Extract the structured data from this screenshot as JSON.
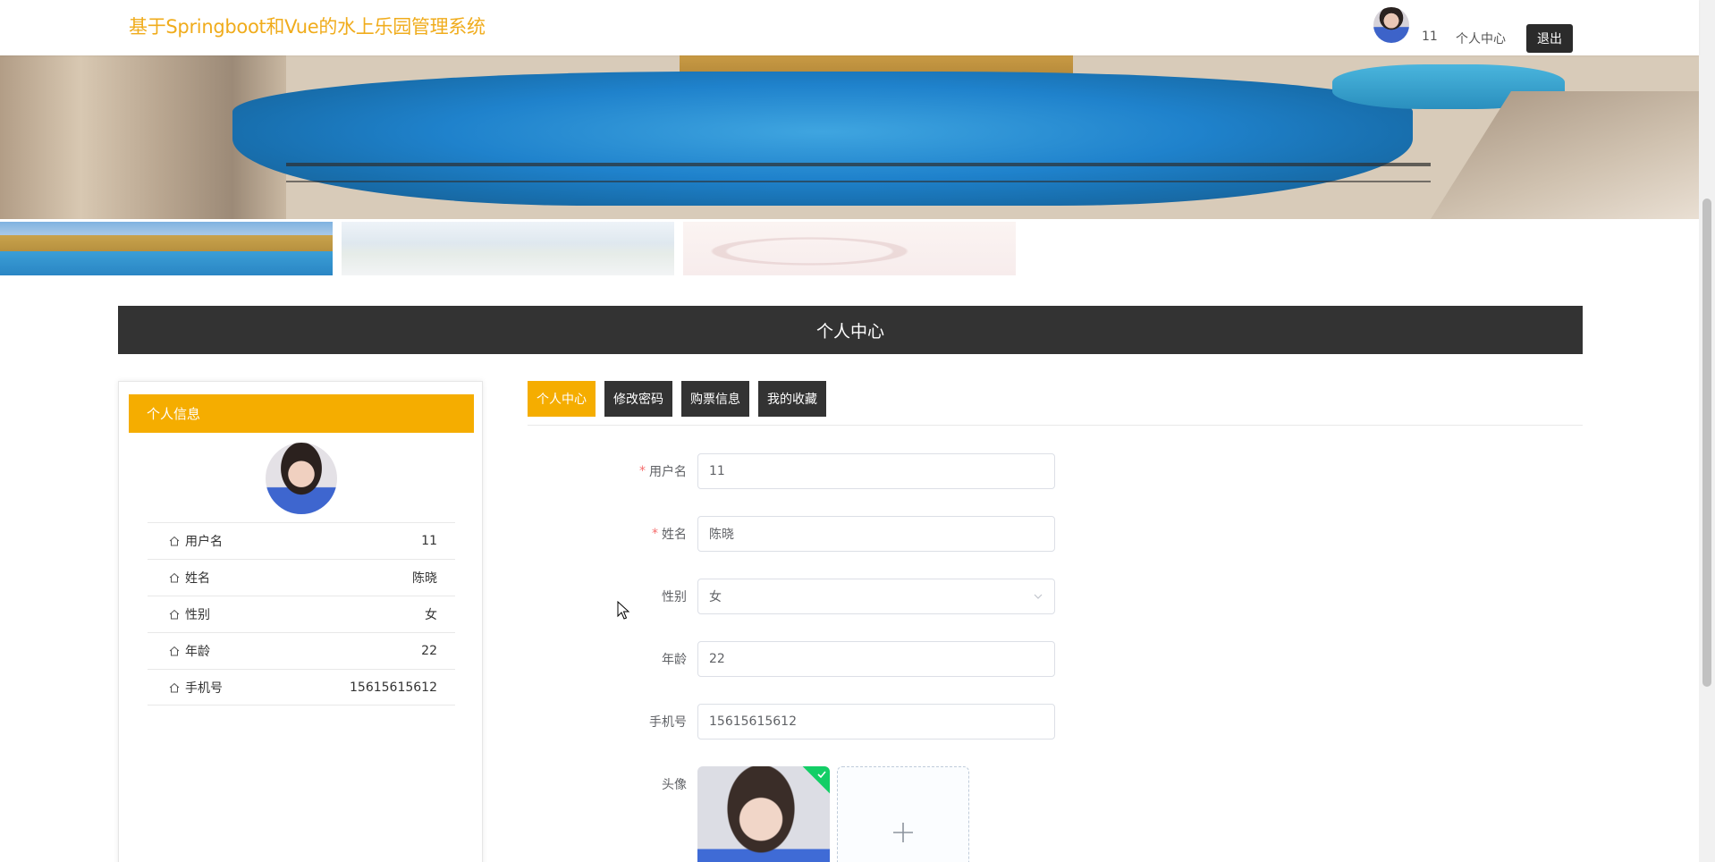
{
  "header": {
    "title": "基于Springboot和Vue的水上乐园管理系统",
    "username": "11",
    "user_center": "个人中心",
    "logout": "退出"
  },
  "section": {
    "title": "个人中心"
  },
  "profile_card": {
    "title": "个人信息",
    "rows": [
      {
        "label": "用户名",
        "value": "11"
      },
      {
        "label": "姓名",
        "value": "陈晓"
      },
      {
        "label": "性别",
        "value": "女"
      },
      {
        "label": "年龄",
        "value": "22"
      },
      {
        "label": "手机号",
        "value": "15615615612"
      }
    ]
  },
  "tabs": [
    {
      "label": "个人中心",
      "active": true
    },
    {
      "label": "修改密码",
      "active": false
    },
    {
      "label": "购票信息",
      "active": false
    },
    {
      "label": "我的收藏",
      "active": false
    }
  ],
  "form": {
    "username": {
      "label": "用户名",
      "value": "11",
      "required": true
    },
    "name": {
      "label": "姓名",
      "value": "陈晓",
      "required": true
    },
    "gender": {
      "label": "性别",
      "value": "女"
    },
    "age": {
      "label": "年龄",
      "value": "22"
    },
    "phone": {
      "label": "手机号",
      "value": "15615615612"
    },
    "avatar": {
      "label": "头像"
    }
  },
  "colors": {
    "accent": "#f5ad00",
    "title": "#f0ac1c",
    "dark": "#333333",
    "required": "#f56c6c"
  }
}
